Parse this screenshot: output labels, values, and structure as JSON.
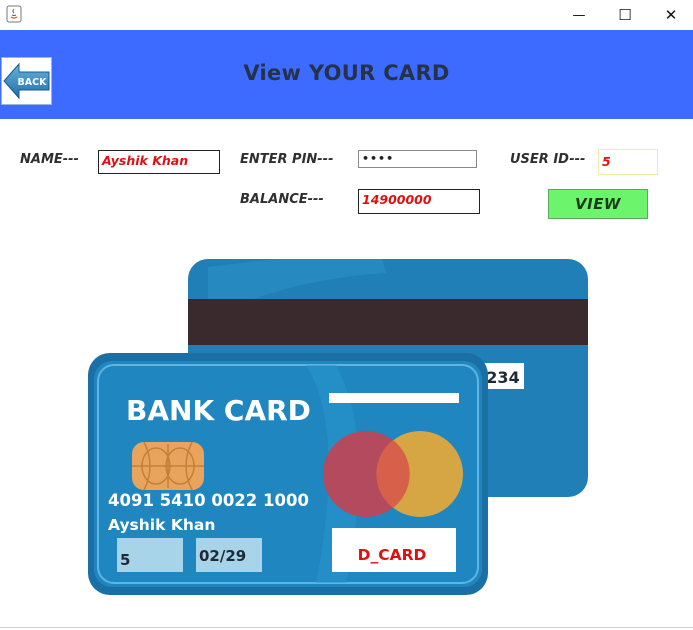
{
  "window": {
    "minimize_glyph": "—",
    "maximize_glyph": "☐",
    "close_glyph": "✕"
  },
  "header": {
    "title": "View YOUR CARD",
    "back_label": "BACK",
    "background": "#3d6bff"
  },
  "form": {
    "name_label": "NAME---",
    "name_value": "Ayshik Khan",
    "pin_label": "ENTER PIN---",
    "pin_value": "••••",
    "user_id_label": "USER ID---",
    "user_id_value": "5",
    "balance_label": "BALANCE---",
    "balance_value": "14900000",
    "view_button": "VIEW"
  },
  "card": {
    "bank_title": "BANK CARD",
    "number": "4091 5410 0022  1000",
    "holder": "Ayshik Khan",
    "user_id": "5",
    "expiry": "02/29",
    "type": "D_CARD",
    "back_card_digits": "234"
  },
  "colors": {
    "field_text": "#e01010",
    "view_button": "#6cf56c",
    "card_blue": "#1f7fb6"
  }
}
